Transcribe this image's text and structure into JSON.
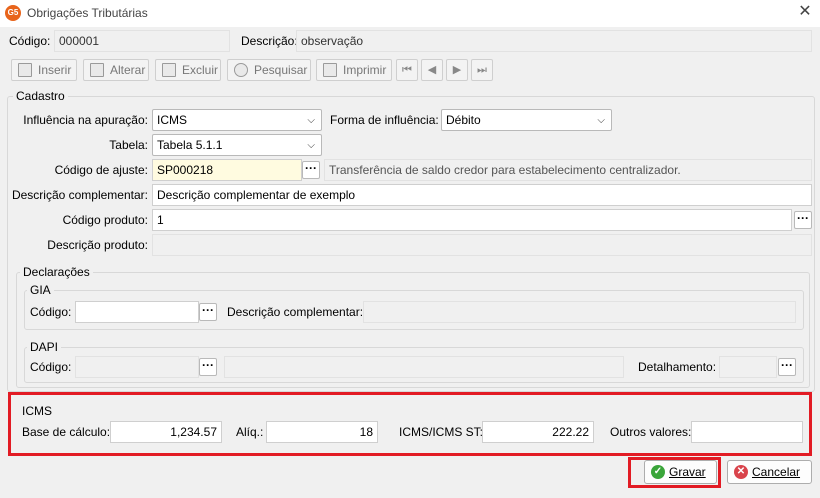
{
  "window": {
    "title": "Obrigações Tributárias",
    "app_icon_text": "G5"
  },
  "header": {
    "codigo_label": "Código:",
    "codigo_value": "000001",
    "descricao_label": "Descrição:",
    "descricao_value": "observação"
  },
  "toolbar": {
    "inserir": "Inserir",
    "alterar": "Alterar",
    "excluir": "Excluir",
    "pesquisar": "Pesquisar",
    "imprimir": "Imprimir"
  },
  "cadastro": {
    "title": "Cadastro",
    "influencia_label": "Influência na apuração:",
    "influencia_value": "ICMS",
    "forma_label": "Forma de influência:",
    "forma_value": "Débito",
    "tabela_label": "Tabela:",
    "tabela_value": "Tabela 5.1.1",
    "codigo_ajuste_label": "Código de ajuste:",
    "codigo_ajuste_value": "SP000218",
    "codigo_ajuste_desc": "Transferência de saldo credor  para estabelecimento centralizador.",
    "desc_compl_label": "Descrição complementar:",
    "desc_compl_value": "Descrição complementar de exemplo",
    "codigo_produto_label": "Código produto:",
    "codigo_produto_value": "1",
    "descricao_produto_label": "Descrição produto:",
    "descricao_produto_value": ""
  },
  "declaracoes": {
    "title": "Declarações",
    "gia": {
      "title": "GIA",
      "codigo_label": "Código:",
      "codigo_value": "",
      "desc_compl_label": "Descrição complementar:",
      "desc_compl_value": ""
    },
    "dapi": {
      "title": "DAPI",
      "codigo_label": "Código:",
      "codigo_value": "",
      "detalhamento_label": "Detalhamento:",
      "detalhamento_value": ""
    }
  },
  "icms": {
    "title": "ICMS",
    "base_label": "Base de cálculo:",
    "base_value": "1,234.57",
    "aliq_label": "Alíq.:",
    "aliq_value": "18",
    "icms_st_label": "ICMS/ICMS ST:",
    "icms_st_value": "222.22",
    "outros_label": "Outros valores:",
    "outros_value": ""
  },
  "footer": {
    "gravar": "Gravar",
    "cancelar": "Cancelar"
  },
  "colors": {
    "highlight": "#e21b24",
    "yellow_field": "#fffbe0",
    "gravar_icon": "#3aa53a",
    "cancelar_icon": "#d9434b"
  }
}
